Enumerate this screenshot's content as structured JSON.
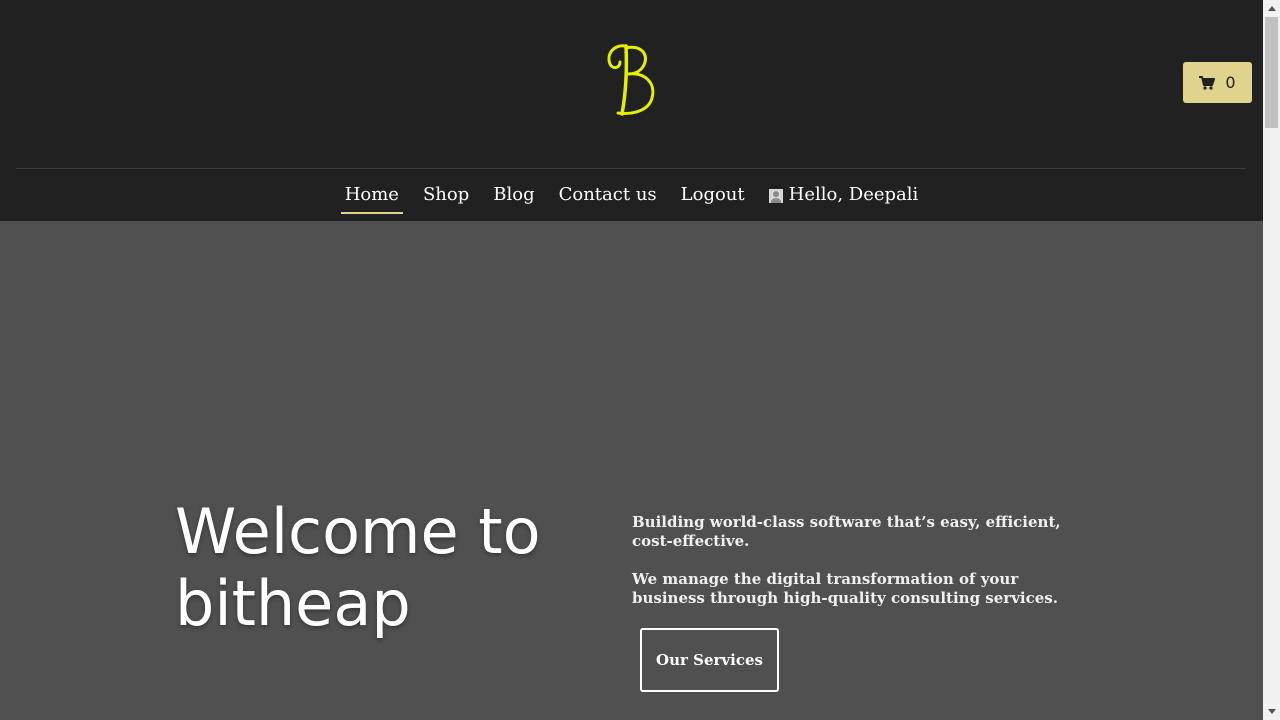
{
  "header": {
    "logo_letter": "B",
    "cart": {
      "icon": "shopping-cart-icon",
      "count": "0"
    },
    "nav": [
      {
        "label": "Home",
        "active": true
      },
      {
        "label": "Shop"
      },
      {
        "label": "Blog"
      },
      {
        "label": "Contact us"
      },
      {
        "label": "Logout"
      }
    ],
    "user_greeting": "Hello, Deepali"
  },
  "hero": {
    "title": "Welcome to bitheap",
    "paragraph1": "Building world-class software that’s easy, efficient, cost-effective.",
    "paragraph2": "We manage the digital transformation of your business through high-quality consulting services.",
    "cta_label": "Our Services"
  },
  "colors": {
    "header_bg": "#212121",
    "hero_bg": "#505050",
    "accent": "#dfd38e",
    "logo": "#e3f000"
  }
}
